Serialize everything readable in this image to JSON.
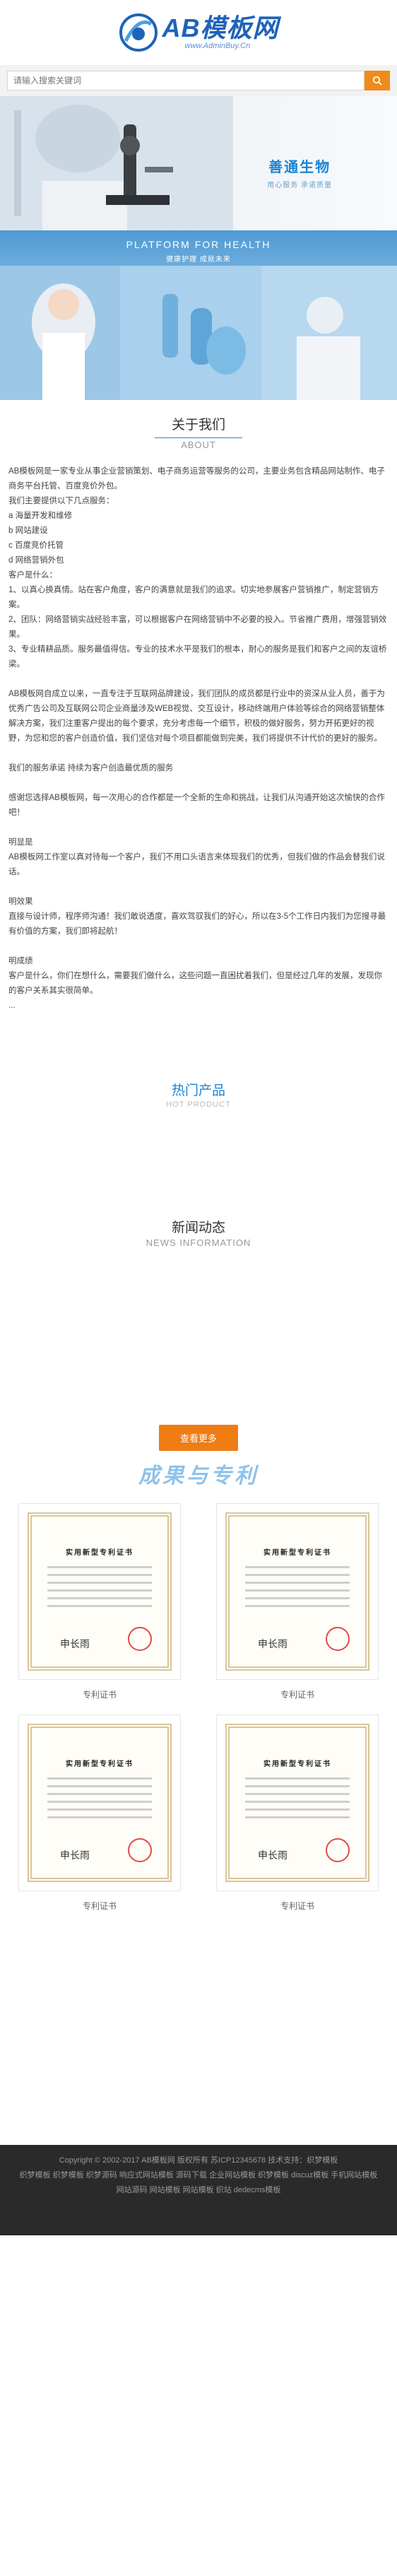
{
  "header": {
    "logo_title": "AB模板网",
    "logo_sub": "www.AdminBuy.Cn"
  },
  "search": {
    "placeholder": "请输入搜索关键词",
    "icon": "search-icon"
  },
  "banner": {
    "brand_title": "善通生物",
    "brand_sub": "用心服务  承诺质量",
    "slogan_en": "PLATFORM FOR HEALTH",
    "slogan_cn": "健康护理 成就未来"
  },
  "about": {
    "title_cn": "关于我们",
    "title_en": "ABOUT",
    "paragraphs": [
      "AB模板网是一家专业从事企业营销策划、电子商务运营等服务的公司，主要业务包含精品网站制作、电子商务平台托管、百度竞价外包。",
      "我们主要提供以下几点服务：",
      "a  海量开发和维修",
      "b  网站建设",
      "c  百度竞价托管",
      "d  网络营销外包",
      "客户是什么：",
      "1、以真心换真情。站在客户角度，客户的满意就是我们的追求。切实地参展客户营销推广，制定营销方案。",
      "2、团队：网络营销实战经验丰富，可以根据客户在网络营销中不必要的投入。节省推广费用，增强营销效果。",
      "3、专业精耕品质。服务最值得信。专业的技术水平是我们的根本，耐心的服务是我们和客户之间的友谊桥梁。",
      "",
      "AB模板网自成立以来，一直专注于互联网品牌建设，我们团队的成员都是行业中的资深从业人员，善于为优秀广告公司及互联网公司企业商量涉及WEB视觉、交互设计，移动终端用户体验等综合的网络营销整体解决方案，我们注重客户提出的每个要求，充分考虑每一个细节，积极的做好服务，努力开拓更好的视野，为您和您的客户创造价值，我们坚信对每个项目都能做到完美，我们将提供不计代价的更好的服务。",
      "",
      "我们的服务承诺  持续为客户创造最优质的服务",
      "",
      "感谢您选择AB模板网，每一次用心的合作都是一个全新的生命和挑战，让我们从沟通开始这次愉快的合作吧！",
      "",
      "明显是",
      "AB模板网工作室以真对待每一个客户，我们不用口头语言来体现我们的优秀，但我们做的作品会替我们说话。",
      "",
      "明效果",
      "直接与设计师，程序师沟通！我们敢说透度，喜欢驾驭我们的好心，所以在3-5个工作日内我们为您搜寻最有价值的方案，我们即将起航！",
      "",
      "明成绩",
      "客户是什么，你们在想什么，需要我们做什么，这些问题一直困扰着我们，但是经过几年的发展，发现你的客户关系其实很简单。",
      "..."
    ]
  },
  "products": {
    "title_cn": "热门产品",
    "title_en": "HOT PRODUCT"
  },
  "news": {
    "title_cn": "新闻动态",
    "title_en": "NEWS INFORMATION"
  },
  "more_label": "查看更多",
  "honor": {
    "banner": "成果与专利",
    "certificates": [
      {
        "caption": "专利证书",
        "title": "实用新型专利证书"
      },
      {
        "caption": "专利证书",
        "title": "实用新型专利证书"
      },
      {
        "caption": "专利证书",
        "title": "实用新型专利证书"
      },
      {
        "caption": "专利证书",
        "title": "实用新型专利证书"
      }
    ]
  },
  "footer": {
    "copyright": "Copyright © 2002-2017 AB模板网 版权所有 苏ICP12345678 技术支持：织梦模板",
    "links_1": "织梦模板 织梦模板 织梦源码 响应式网站模板 源码下载 企业网站模板 织梦模板 discuz模板 手机网站模板",
    "links_2": "网站源码 网站模板 网站模板 织站 dedecms模板"
  },
  "colors": {
    "brand_blue": "#1e63b8",
    "accent_orange": "#ef7d14",
    "footer_bg": "#2a2a2a"
  }
}
